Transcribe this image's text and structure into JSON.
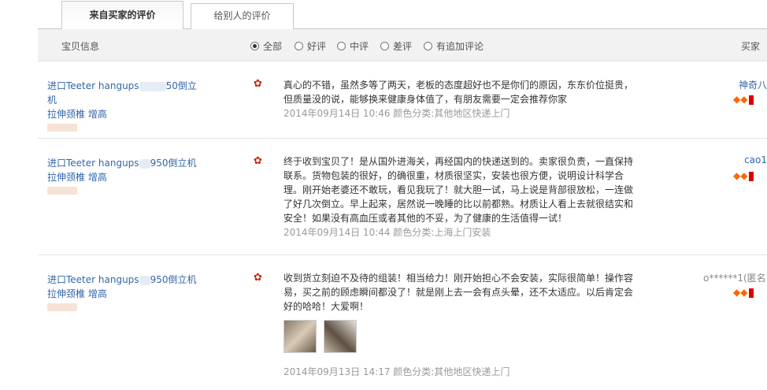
{
  "tabs": {
    "active_label": "来自买家的评价",
    "inactive_label": "给别人的评价"
  },
  "filter": {
    "info_label": "宝贝信息",
    "buyer_label": "买家",
    "options": [
      "全部",
      "好评",
      "中评",
      "差评",
      "有追加评论"
    ],
    "selected": "全部"
  },
  "reviews": [
    {
      "product_line1": "进口Teeter hangups",
      "product_line1_tail": "50倒立机",
      "product_line2": "拉伸颈椎 增高",
      "comment": "真心的不错，虽然多等了两天，老板的态度超好也不是你们的原因，东东价位挺贵，但质量没的说，能够换来健康身体值了，有朋友需要一定会推荐你家",
      "date": "2014年09月14日 10:46 颜色分类:其他地区快递上门",
      "buyer": "神奇八",
      "gems": "◆◆"
    },
    {
      "product_line1": "进口Teeter hangups",
      "product_line1_tail": "950倒立机",
      "product_line2": "拉伸颈椎 增高",
      "comment": "终于收到宝贝了！是从国外进海关，再经国内的快递送到的。卖家很负责，一直保持联系。货物包装的很好，的确很重，材质很坚实，安装也很方便，说明设计科学合理。刚开始老婆还不敢玩，看见我玩了！就大胆一试，马上说是背部很放松，一连做了好几次倒立。早上起来，居然说一晚睡的比以前都熟。材质让人看上去就很结实和安全！如果没有高血压或者其他的不妥，为了健康的生活值得一试！",
      "date": "2014年09月14日 10:44 颜色分类:上海上门安装",
      "buyer": "cao1",
      "gems": "◆◆"
    },
    {
      "product_line1": "进口Teeter hangups",
      "product_line1_tail": "950倒立机",
      "product_line2": "拉伸颈椎 增高",
      "comment": "收到货立刻迫不及待的组装！相当给力！刚开始担心不会安装，实际很简单！操作容易，买之前的顾虑瞬间都没了！就是刚上去一会有点头晕，还不太适应。以后肯定会好的哈哈！大爱啊！",
      "date": "2014年09月13日 14:17 颜色分类:其他地区快递上门",
      "buyer": "o******1(匿名",
      "gems": "◆◆"
    }
  ],
  "icons": {
    "flower": "flower-icon",
    "gem": "gem-icon"
  },
  "colors": {
    "link": "#3366aa",
    "date": "#999999",
    "tab_border": "#c9c9c9",
    "filter_bg": "#f2f2f2"
  }
}
